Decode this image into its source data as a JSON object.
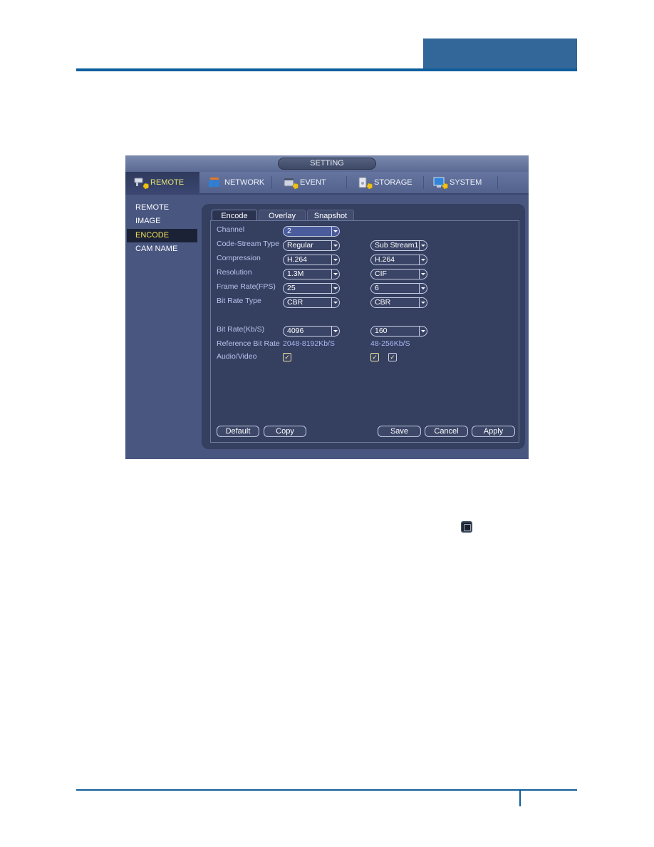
{
  "page": {
    "header_accent": "#336699",
    "rule_color": "#0f5e9c"
  },
  "window": {
    "title": "SETTING"
  },
  "topnav": {
    "tabs": [
      {
        "label": "REMOTE",
        "icon": "remote-camera-icon",
        "active": true
      },
      {
        "label": "NETWORK",
        "icon": "network-icon",
        "active": false
      },
      {
        "label": "EVENT",
        "icon": "event-icon",
        "active": false
      },
      {
        "label": "STORAGE",
        "icon": "storage-icon",
        "active": false
      },
      {
        "label": "SYSTEM",
        "icon": "system-icon",
        "active": false
      }
    ]
  },
  "sidebar": {
    "items": [
      {
        "label": "REMOTE",
        "active": false
      },
      {
        "label": "IMAGE",
        "active": false
      },
      {
        "label": "ENCODE",
        "active": true
      },
      {
        "label": "CAM NAME",
        "active": false
      }
    ]
  },
  "subtabs": [
    {
      "label": "Encode",
      "active": true
    },
    {
      "label": "Overlay",
      "active": false
    },
    {
      "label": "Snapshot",
      "active": false
    }
  ],
  "form": {
    "channel": {
      "label": "Channel",
      "value": "2"
    },
    "code_stream_type": {
      "label": "Code-Stream Type",
      "main": "Regular",
      "sub": "Sub Stream1"
    },
    "compression": {
      "label": "Compression",
      "main": "H.264",
      "sub": "H.264"
    },
    "resolution": {
      "label": "Resolution",
      "main": "1.3M",
      "sub": "CIF"
    },
    "frame_rate": {
      "label": "Frame Rate(FPS)",
      "main": "25",
      "sub": "6"
    },
    "bit_rate_type": {
      "label": "Bit Rate Type",
      "main": "CBR",
      "sub": "CBR"
    },
    "bit_rate": {
      "label": "Bit Rate(Kb/S)",
      "main": "4096",
      "sub": "160"
    },
    "reference_bit_rate": {
      "label": "Reference Bit Rate",
      "main": "2048-8192Kb/S",
      "sub": "48-256Kb/S"
    },
    "audio_video": {
      "label": "Audio/Video",
      "main_checked": true,
      "sub_video_checked": true,
      "sub_audio_checked": true
    }
  },
  "buttons": {
    "default": "Default",
    "copy": "Copy",
    "save": "Save",
    "cancel": "Cancel",
    "apply": "Apply"
  },
  "check_glyph": "✓"
}
